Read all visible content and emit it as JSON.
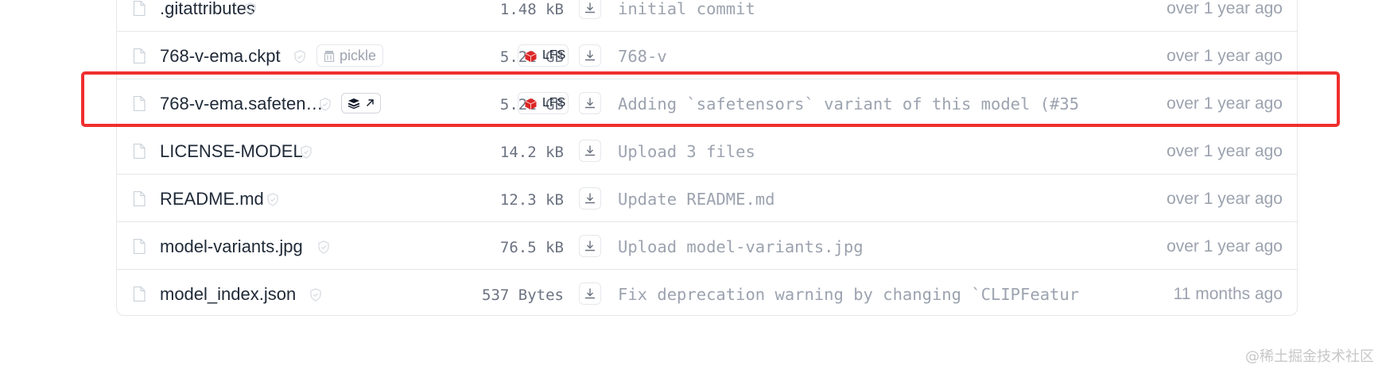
{
  "files": [
    {
      "name": ".gitattributes",
      "size": "1.48 kB",
      "lfs": false,
      "commit": "initial commit",
      "date": "over 1 year ago"
    },
    {
      "name": "768-v-ema.ckpt",
      "size": "5.21 GB",
      "lfs": true,
      "badge": "pickle",
      "commit": "768-v",
      "date": "over 1 year ago"
    },
    {
      "name": "768-v-ema.safeten…",
      "size": "5.21 GB",
      "lfs": true,
      "badge": "safetensors-link",
      "commit": "Adding `safetensors` variant of this model (#35",
      "date": "over 1 year ago"
    },
    {
      "name": "LICENSE-MODEL",
      "size": "14.2 kB",
      "lfs": false,
      "commit": "Upload 3 files",
      "date": "over 1 year ago"
    },
    {
      "name": "README.md",
      "size": "12.3 kB",
      "lfs": false,
      "commit": "Update README.md",
      "date": "over 1 year ago"
    },
    {
      "name": "model-variants.jpg",
      "size": "76.5 kB",
      "lfs": false,
      "commit": "Upload model-variants.jpg",
      "date": "over 1 year ago"
    },
    {
      "name": "model_index.json",
      "size": "537 Bytes",
      "lfs": false,
      "commit": "Fix deprecation warning by changing `CLIPFeatur",
      "date": "11 months ago"
    }
  ],
  "labels": {
    "pickle": "pickle",
    "lfs": "LFS"
  },
  "icons": {
    "file": "file-icon",
    "safe": "shield-check-icon",
    "pickle": "pickle-jar-icon",
    "safetensors": "safetensors-layers-icon",
    "lfs": "lfs-cube-icon",
    "download": "download-icon"
  },
  "colors": {
    "highlight": "#ef2e2e",
    "lfs_cube": "#dc2626",
    "muted_text": "#9ca3af",
    "row_border": "#e5e7eb"
  },
  "watermark": "@稀土掘金技术社区"
}
